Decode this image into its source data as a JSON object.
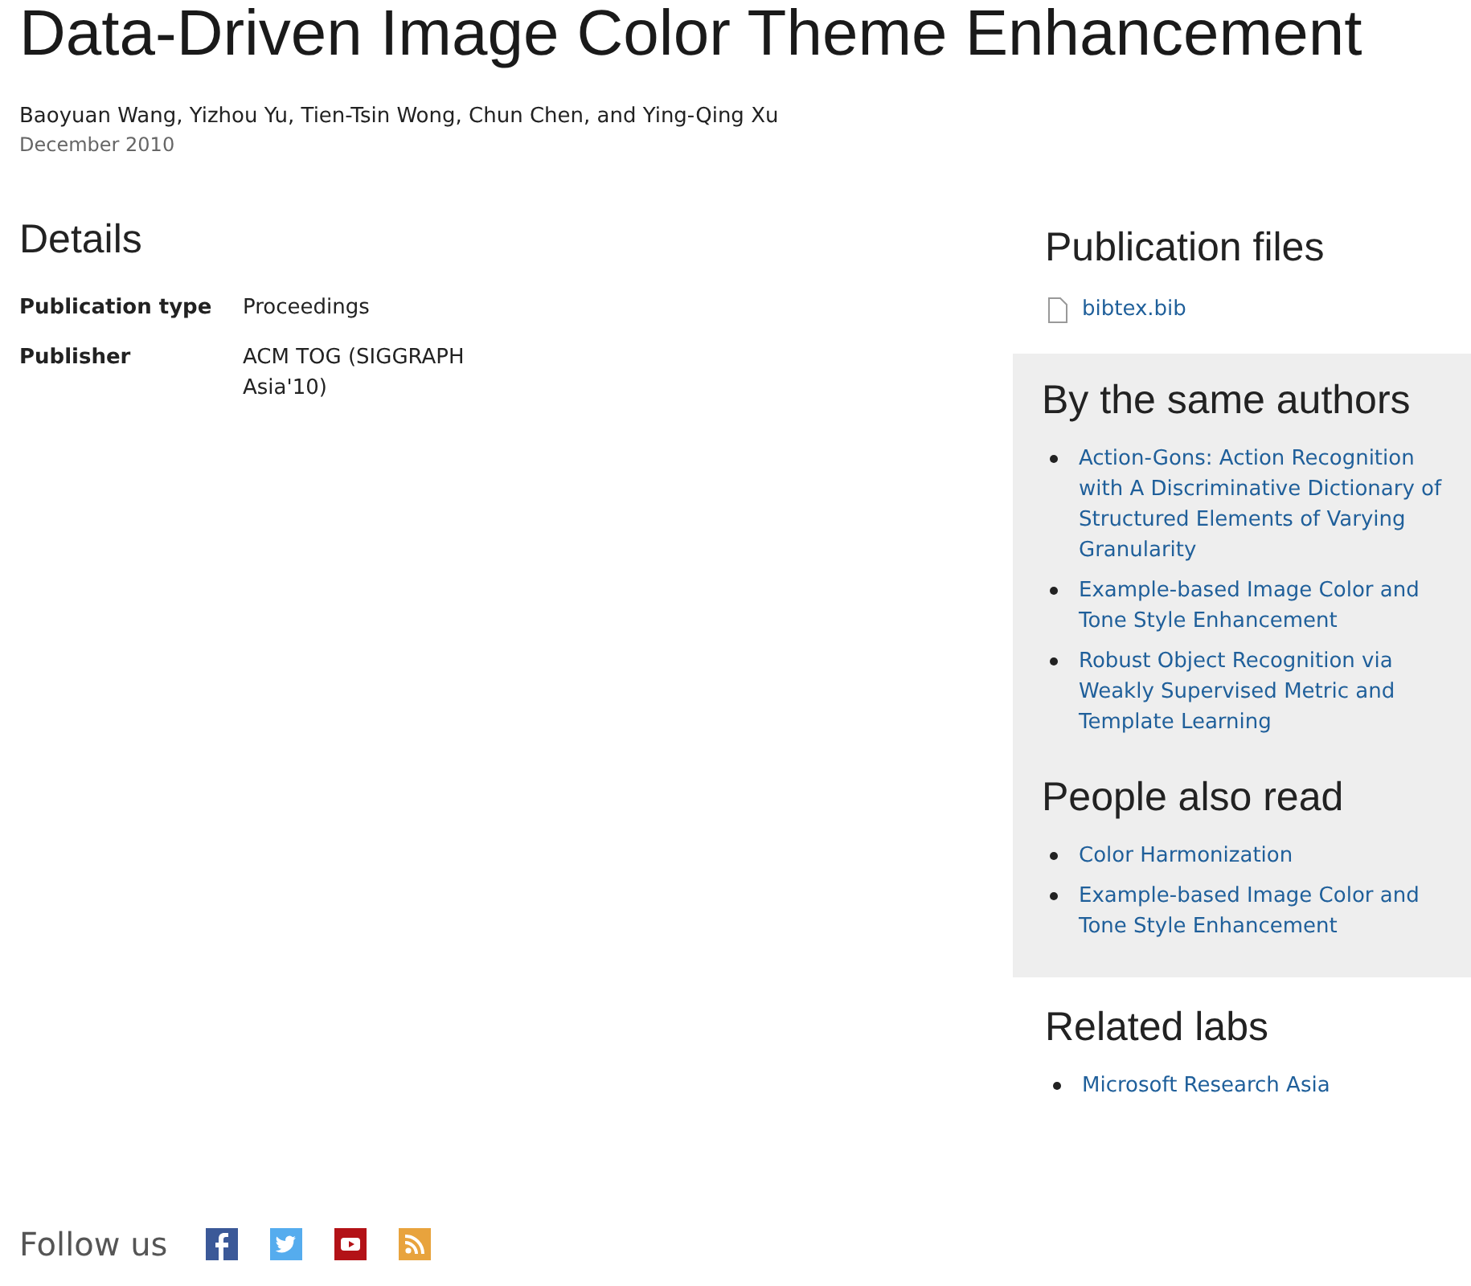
{
  "title": "Data-Driven Image Color Theme Enhancement",
  "authors": "Baoyuan Wang, Yizhou Yu, Tien-Tsin Wong, Chun Chen, and Ying-Qing Xu",
  "date": "December 2010",
  "details": {
    "heading": "Details",
    "rows": [
      {
        "label": "Publication type",
        "value": "Proceedings"
      },
      {
        "label": "Publisher",
        "value": "ACM TOG (SIGGRAPH Asia'10)"
      }
    ]
  },
  "publication_files": {
    "heading": "Publication files",
    "files": [
      "bibtex.bib"
    ]
  },
  "same_authors": {
    "heading": "By the same authors",
    "links": [
      "Action-Gons: Action Recognition with A Discriminative Dictionary of Structured Elements of Varying Granularity",
      "Example-based Image Color and Tone Style Enhancement",
      "Robust Object Recognition via Weakly Supervised Metric and Template Learning"
    ]
  },
  "people_also_read": {
    "heading": "People also read",
    "links": [
      "Color Harmonization",
      "Example-based Image Color and Tone Style Enhancement"
    ]
  },
  "related_labs": {
    "heading": "Related labs",
    "links": [
      "Microsoft Research Asia"
    ]
  },
  "follow": {
    "label": "Follow us",
    "icons": [
      {
        "kind": "facebook"
      },
      {
        "kind": "twitter"
      },
      {
        "kind": "youtube"
      },
      {
        "kind": "rss"
      }
    ]
  }
}
